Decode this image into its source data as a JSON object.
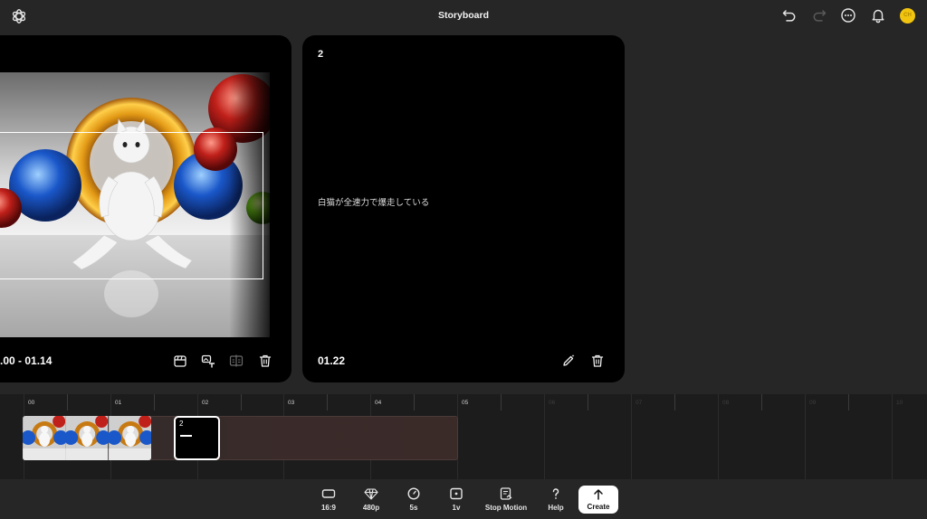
{
  "header": {
    "title": "Storyboard",
    "avatar_text": "CH"
  },
  "cards": [
    {
      "time_range": ".00 - 01.14"
    },
    {
      "number": "2",
      "prompt": "白猫が全速力で爆走している",
      "time": "01.22"
    }
  ],
  "timeline": {
    "ruler": [
      "00",
      "01",
      "02",
      "03",
      "04",
      "05",
      "06",
      "07",
      "08",
      "09",
      "10"
    ],
    "clip2_number": "2"
  },
  "toolbar": {
    "aspect_label": "16:9",
    "resolution_label": "480p",
    "duration_label": "5s",
    "variations_label": "1v",
    "stop_motion_label": "Stop Motion",
    "help_label": "Help",
    "create_label": "Create"
  },
  "colors": {
    "background": "#262626",
    "card": "#000000",
    "timeline": "#1c1c1c",
    "avatar": "#f1c40f",
    "clip_track": "#3a2b2a"
  }
}
